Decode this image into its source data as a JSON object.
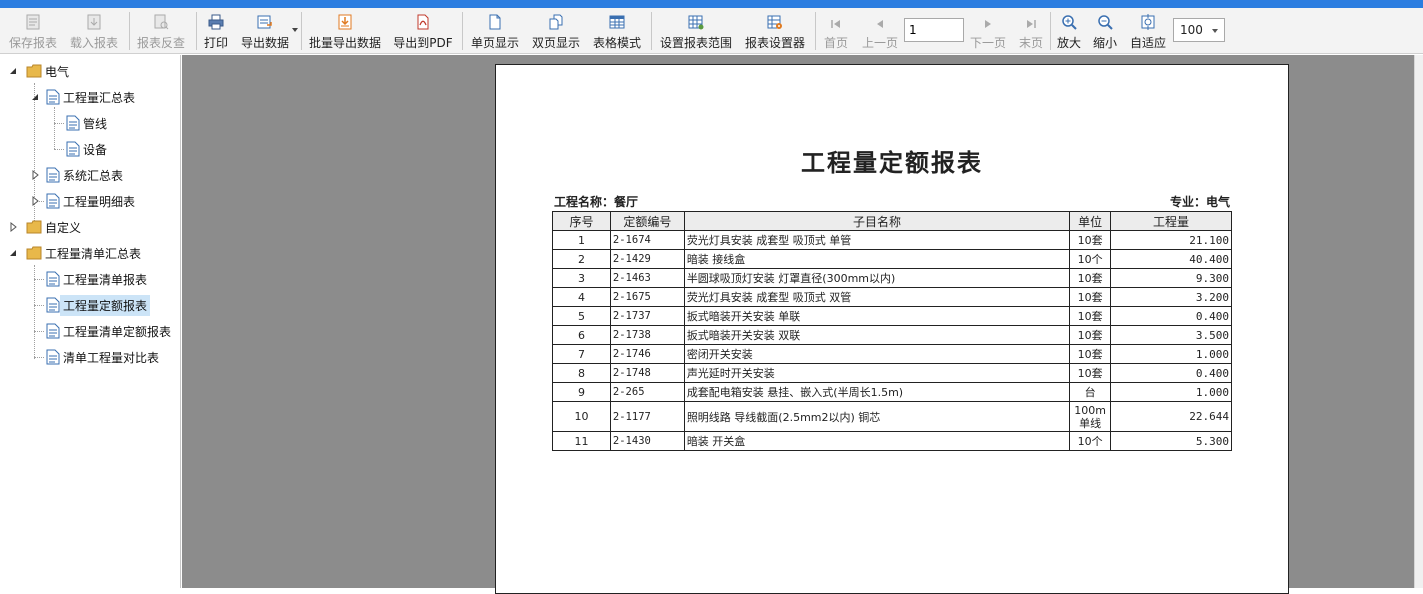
{
  "toolbar": {
    "buttons": [
      {
        "label": "保存报表",
        "icon": "save-report-icon",
        "enabled": false
      },
      {
        "label": "载入报表",
        "icon": "load-report-icon",
        "enabled": false
      },
      {
        "label": "报表反查",
        "icon": "report-lookup-icon",
        "enabled": false
      },
      {
        "label": "打印",
        "icon": "printer-icon",
        "enabled": true
      },
      {
        "label": "导出数据",
        "icon": "export-data-icon",
        "enabled": true
      },
      {
        "label": "批量导出数据",
        "icon": "batch-export-icon",
        "enabled": true
      },
      {
        "label": "导出到PDF",
        "icon": "pdf-icon",
        "enabled": true
      },
      {
        "label": "单页显示",
        "icon": "single-page-icon",
        "enabled": true
      },
      {
        "label": "双页显示",
        "icon": "double-page-icon",
        "enabled": true
      },
      {
        "label": "表格模式",
        "icon": "table-mode-icon",
        "enabled": true
      },
      {
        "label": "设置报表范围",
        "icon": "report-range-icon",
        "enabled": true
      },
      {
        "label": "报表设置器",
        "icon": "report-settings-icon",
        "enabled": true
      },
      {
        "label": "首页",
        "icon": "first-page-icon",
        "enabled": false
      },
      {
        "label": "上一页",
        "icon": "prev-page-icon",
        "enabled": false
      },
      {
        "label": "下一页",
        "icon": "next-page-icon",
        "enabled": false
      },
      {
        "label": "末页",
        "icon": "last-page-icon",
        "enabled": false
      },
      {
        "label": "放大",
        "icon": "zoom-in-icon",
        "enabled": true
      },
      {
        "label": "缩小",
        "icon": "zoom-out-icon",
        "enabled": true
      },
      {
        "label": "自适应",
        "icon": "fit-page-icon",
        "enabled": true
      }
    ],
    "page_value": "1",
    "zoom_value": "100"
  },
  "tree": {
    "n1": "电气",
    "n1a": "工程量汇总表",
    "n1a1": "管线",
    "n1a2": "设备",
    "n1b": "系统汇总表",
    "n1c": "工程量明细表",
    "n2": "自定义",
    "n3": "工程量清单汇总表",
    "n3a": "工程量清单报表",
    "n3b": "工程量定额报表",
    "n3c": "工程量清单定额报表",
    "n3d": "清单工程量对比表"
  },
  "report": {
    "title": "工程量定额报表",
    "project": "工程名称：餐厅",
    "discipline": "专业：电气",
    "headers": [
      "序号",
      "定额编号",
      "子目名称",
      "单位",
      "工程量"
    ],
    "rows": [
      [
        "1",
        "2-1674",
        "荧光灯具安装 成套型 吸顶式 单管",
        "10套",
        "21.100"
      ],
      [
        "2",
        "2-1429",
        "暗装 接线盒",
        "10个",
        "40.400"
      ],
      [
        "3",
        "2-1463",
        "半圆球吸顶灯安装 灯罩直径(300mm以内)",
        "10套",
        "9.300"
      ],
      [
        "4",
        "2-1675",
        "荧光灯具安装 成套型 吸顶式 双管",
        "10套",
        "3.200"
      ],
      [
        "5",
        "2-1737",
        "扳式暗装开关安装 单联",
        "10套",
        "0.400"
      ],
      [
        "6",
        "2-1738",
        "扳式暗装开关安装 双联",
        "10套",
        "3.500"
      ],
      [
        "7",
        "2-1746",
        "密闭开关安装",
        "10套",
        "1.000"
      ],
      [
        "8",
        "2-1748",
        "声光延时开关安装",
        "10套",
        "0.400"
      ],
      [
        "9",
        "2-265",
        "成套配电箱安装 悬挂、嵌入式(半周长1.5m)",
        "台",
        "1.000"
      ],
      [
        "10",
        "2-1177",
        "照明线路 导线截面(2.5mm2以内) 铜芯",
        "100m单线",
        "22.644"
      ],
      [
        "11",
        "2-1430",
        "暗装 开关盒",
        "10个",
        "5.300"
      ]
    ]
  }
}
